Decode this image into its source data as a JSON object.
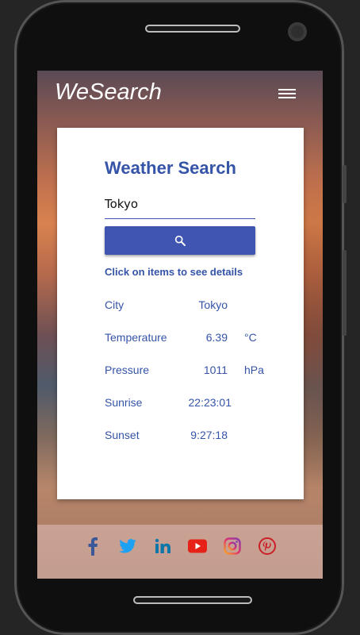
{
  "app": {
    "brand": "WeSearch"
  },
  "search": {
    "title": "Weather Search",
    "query": "Tokyo",
    "hint": "Click on items to see details"
  },
  "results": [
    {
      "label": "City",
      "value": "Tokyo",
      "unit": ""
    },
    {
      "label": "Temperature",
      "value": "6.39",
      "unit": "°C"
    },
    {
      "label": "Pressure",
      "value": "1011",
      "unit": "hPa"
    },
    {
      "label": "Sunrise",
      "value": "22:23:01",
      "unit": ""
    },
    {
      "label": "Sunset",
      "value": "9:27:18",
      "unit": ""
    }
  ],
  "icons": {
    "menu": "hamburger-menu-icon",
    "search": "search-icon",
    "social": [
      "facebook-icon",
      "twitter-icon",
      "linkedin-icon",
      "youtube-icon",
      "instagram-icon",
      "pinterest-icon"
    ]
  },
  "colors": {
    "accent": "#3f55b0",
    "text_accent": "#3554a8",
    "facebook": "#3b5998",
    "twitter": "#1da1f2",
    "linkedin": "#0e76a8",
    "youtube": "#e62117",
    "instagram": "#c13584",
    "pinterest": "#cb2027"
  }
}
